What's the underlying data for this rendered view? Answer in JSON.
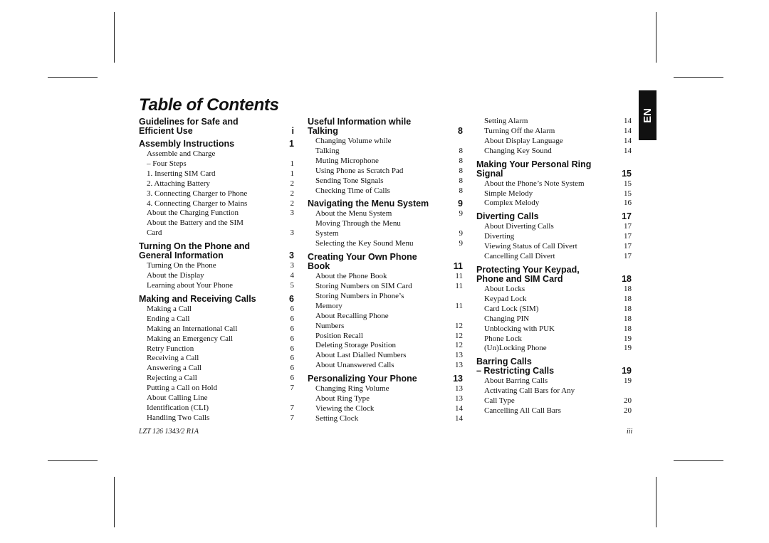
{
  "title": "Table of Contents",
  "language_tab": "EN",
  "footer": {
    "doc_id": "LZT 126 1343/2 R1A",
    "page": "iii"
  },
  "columns": [
    [
      {
        "t": "h",
        "lines": [
          "Guidelines for Safe and",
          "Efficient Use"
        ],
        "page": "i"
      },
      {
        "t": "h",
        "lines": [
          "Assembly Instructions"
        ],
        "page": "1"
      },
      {
        "t": "s",
        "lines": [
          "Assemble and Charge",
          "– Four Steps"
        ],
        "page": "1"
      },
      {
        "t": "s",
        "lines": [
          "1. Inserting SIM Card"
        ],
        "page": "1"
      },
      {
        "t": "s",
        "lines": [
          "2. Attaching Battery"
        ],
        "page": "2"
      },
      {
        "t": "s",
        "lines": [
          "3. Connecting Charger to Phone"
        ],
        "page": "2"
      },
      {
        "t": "s",
        "lines": [
          "4. Connecting Charger to Mains"
        ],
        "page": "2"
      },
      {
        "t": "s",
        "lines": [
          "About the Charging Function"
        ],
        "page": "3"
      },
      {
        "t": "s",
        "lines": [
          "About the Battery and the SIM",
          "Card"
        ],
        "page": "3"
      },
      {
        "t": "h",
        "lines": [
          "Turning On the Phone and",
          "General Information"
        ],
        "page": "3"
      },
      {
        "t": "s",
        "lines": [
          "Turning On the Phone"
        ],
        "page": "3"
      },
      {
        "t": "s",
        "lines": [
          "About the Display"
        ],
        "page": "4"
      },
      {
        "t": "s",
        "lines": [
          "Learning about Your Phone"
        ],
        "page": "5"
      },
      {
        "t": "h",
        "lines": [
          "Making and Receiving Calls"
        ],
        "page": "6"
      },
      {
        "t": "s",
        "lines": [
          "Making a Call"
        ],
        "page": "6"
      },
      {
        "t": "s",
        "lines": [
          "Ending a Call"
        ],
        "page": "6"
      },
      {
        "t": "s",
        "lines": [
          "Making an International Call"
        ],
        "page": "6"
      },
      {
        "t": "s",
        "lines": [
          "Making an Emergency Call"
        ],
        "page": "6"
      },
      {
        "t": "s",
        "lines": [
          "Retry Function"
        ],
        "page": "6"
      },
      {
        "t": "s",
        "lines": [
          "Receiving a Call"
        ],
        "page": "6"
      },
      {
        "t": "s",
        "lines": [
          "Answering a Call"
        ],
        "page": "6"
      },
      {
        "t": "s",
        "lines": [
          "Rejecting a Call"
        ],
        "page": "6"
      },
      {
        "t": "s",
        "lines": [
          "Putting a Call on Hold"
        ],
        "page": "7"
      },
      {
        "t": "s",
        "lines": [
          "About Calling Line",
          "Identification (CLI)"
        ],
        "page": "7"
      },
      {
        "t": "s",
        "lines": [
          "Handling Two Calls"
        ],
        "page": "7"
      }
    ],
    [
      {
        "t": "h",
        "lines": [
          "Useful Information while",
          "Talking"
        ],
        "page": "8"
      },
      {
        "t": "s",
        "lines": [
          "Changing Volume while",
          "Talking"
        ],
        "page": "8"
      },
      {
        "t": "s",
        "lines": [
          "Muting Microphone"
        ],
        "page": "8"
      },
      {
        "t": "s",
        "lines": [
          "Using Phone as Scratch Pad"
        ],
        "page": "8"
      },
      {
        "t": "s",
        "lines": [
          "Sending Tone Signals"
        ],
        "page": "8"
      },
      {
        "t": "s",
        "lines": [
          "Checking Time of Calls"
        ],
        "page": "8"
      },
      {
        "t": "h",
        "lines": [
          "Navigating the Menu System"
        ],
        "page": "9"
      },
      {
        "t": "s",
        "lines": [
          "About the Menu System"
        ],
        "page": "9"
      },
      {
        "t": "s",
        "lines": [
          "Moving Through the Menu",
          "System"
        ],
        "page": "9"
      },
      {
        "t": "s",
        "lines": [
          "Selecting the Key Sound Menu"
        ],
        "page": "9"
      },
      {
        "t": "h",
        "lines": [
          "Creating Your Own Phone",
          "Book"
        ],
        "page": "11"
      },
      {
        "t": "s",
        "lines": [
          "About the Phone Book"
        ],
        "page": "11"
      },
      {
        "t": "s",
        "lines": [
          "Storing Numbers on SIM Card"
        ],
        "page": "11"
      },
      {
        "t": "s",
        "lines": [
          "Storing Numbers in Phone’s",
          "Memory"
        ],
        "page": "11"
      },
      {
        "t": "s",
        "lines": [
          "About Recalling Phone",
          "Numbers"
        ],
        "page": "12"
      },
      {
        "t": "s",
        "lines": [
          "Position Recall"
        ],
        "page": "12"
      },
      {
        "t": "s",
        "lines": [
          "Deleting Storage Position"
        ],
        "page": "12"
      },
      {
        "t": "s",
        "lines": [
          "About Last Dialled Numbers"
        ],
        "page": "13"
      },
      {
        "t": "s",
        "lines": [
          "About  Unanswered Calls"
        ],
        "page": "13"
      },
      {
        "t": "h",
        "lines": [
          "Personalizing Your Phone"
        ],
        "page": "13"
      },
      {
        "t": "s",
        "lines": [
          "Changing Ring Volume"
        ],
        "page": "13"
      },
      {
        "t": "s",
        "lines": [
          "About Ring Type"
        ],
        "page": "13"
      },
      {
        "t": "s",
        "lines": [
          "Viewing the Clock"
        ],
        "page": "14"
      },
      {
        "t": "s",
        "lines": [
          "Setting Clock"
        ],
        "page": "14"
      }
    ],
    [
      {
        "t": "s",
        "lines": [
          "Setting Alarm"
        ],
        "page": "14"
      },
      {
        "t": "s",
        "lines": [
          "Turning Off the Alarm"
        ],
        "page": "14"
      },
      {
        "t": "s",
        "lines": [
          "About Display Language"
        ],
        "page": "14"
      },
      {
        "t": "s",
        "lines": [
          "Changing Key Sound"
        ],
        "page": "14"
      },
      {
        "t": "h",
        "lines": [
          "Making Your Personal Ring",
          "Signal"
        ],
        "page": "15"
      },
      {
        "t": "s",
        "lines": [
          "About the Phone’s Note System"
        ],
        "page": "15"
      },
      {
        "t": "s",
        "lines": [
          "Simple Melody"
        ],
        "page": "15"
      },
      {
        "t": "s",
        "lines": [
          "Complex Melody"
        ],
        "page": "16"
      },
      {
        "t": "h",
        "lines": [
          "Diverting Calls"
        ],
        "page": "17"
      },
      {
        "t": "s",
        "lines": [
          "About Diverting Calls"
        ],
        "page": "17"
      },
      {
        "t": "s",
        "lines": [
          "Diverting"
        ],
        "page": "17"
      },
      {
        "t": "s",
        "lines": [
          "Viewing Status of Call Divert"
        ],
        "page": "17"
      },
      {
        "t": "s",
        "lines": [
          "Cancelling Call Divert"
        ],
        "page": "17"
      },
      {
        "t": "h",
        "lines": [
          "Protecting Your Keypad,",
          "Phone and SIM Card"
        ],
        "page": "18"
      },
      {
        "t": "s",
        "lines": [
          "About Locks"
        ],
        "page": "18"
      },
      {
        "t": "s",
        "lines": [
          "Keypad Lock"
        ],
        "page": "18"
      },
      {
        "t": "s",
        "lines": [
          "Card Lock (SIM)"
        ],
        "page": "18"
      },
      {
        "t": "s",
        "lines": [
          "Changing PIN"
        ],
        "page": "18"
      },
      {
        "t": "s",
        "lines": [
          "Unblocking with PUK"
        ],
        "page": "18"
      },
      {
        "t": "s",
        "lines": [
          " Phone Lock"
        ],
        "page": "19"
      },
      {
        "t": "s",
        "lines": [
          "(Un)Locking Phone"
        ],
        "page": "19"
      },
      {
        "t": "h",
        "lines": [
          "Barring Calls",
          "– Restricting Calls"
        ],
        "page": "19"
      },
      {
        "t": "s",
        "lines": [
          "About Barring Calls"
        ],
        "page": "19"
      },
      {
        "t": "s",
        "lines": [
          "Activating Call Bars for Any",
          "Call Type"
        ],
        "page": "20"
      },
      {
        "t": "s",
        "lines": [
          "Cancelling All Call Bars"
        ],
        "page": "20"
      }
    ]
  ]
}
